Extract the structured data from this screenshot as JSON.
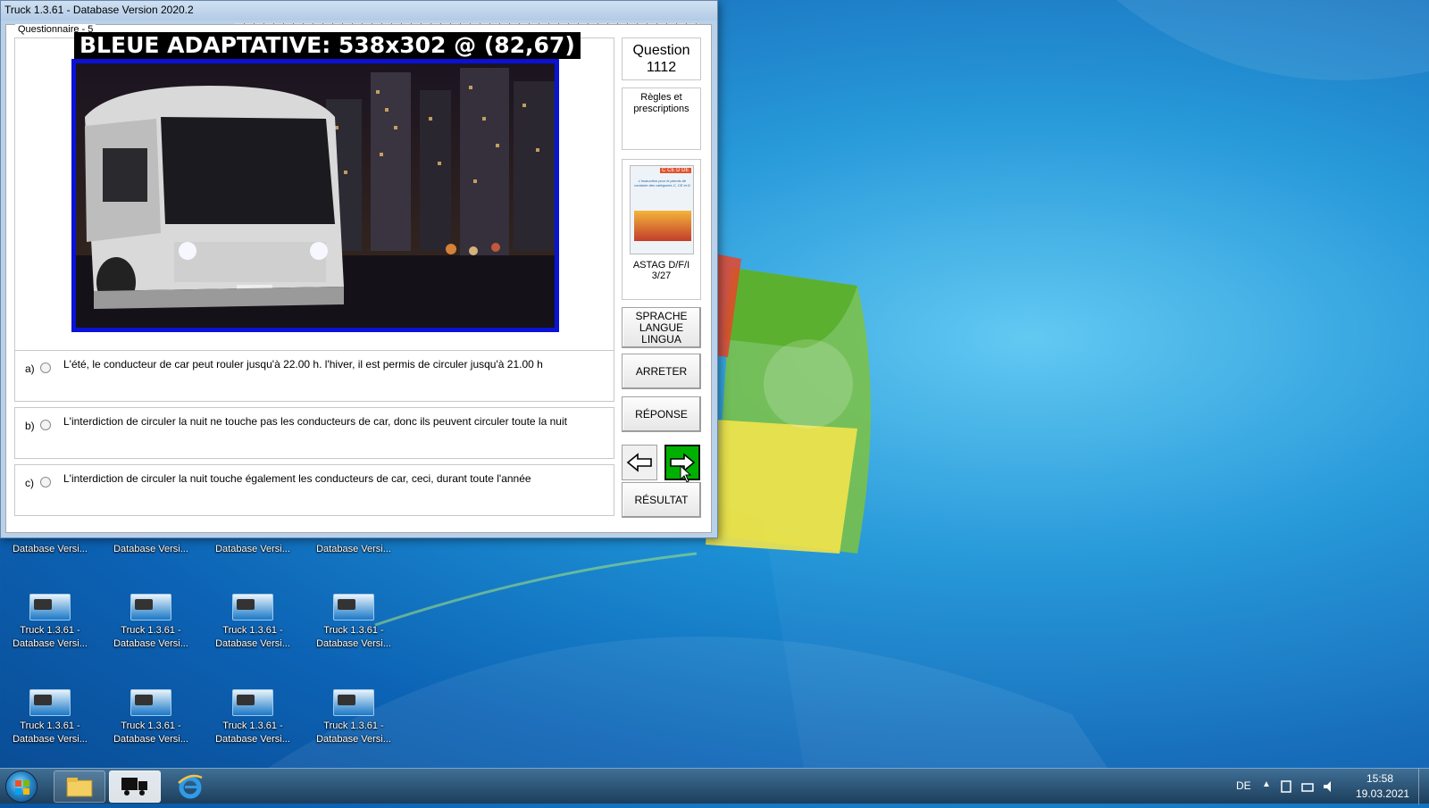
{
  "window": {
    "title": "Truck 1.3.61 - Database Version 2020.2",
    "group_label": "Questionnaire - 5",
    "overlay_label": "BLEUE ADAPTATIVE: 538x302 @ (82,67)"
  },
  "question": {
    "heading": "Question",
    "number": "1112",
    "category": "Règles et prescriptions",
    "book_source": "ASTAG D/F/I",
    "book_page": "3/27",
    "book_cover_text": "L'instruction pour le permis de conduire des catégories C, CE et D",
    "book_cover_tags": "C CE D DE"
  },
  "answers": [
    {
      "letter": "a)",
      "text": "L'été, le conducteur de car peut rouler jusqu'à 22.00 h. l'hiver, il est permis de circuler jusqu'à 21.00 h"
    },
    {
      "letter": "b)",
      "text": "L'interdiction de circuler la nuit ne touche pas les conducteurs de car, donc ils peuvent circuler toute la nuit"
    },
    {
      "letter": "c)",
      "text": "L'interdiction de circuler la nuit touche également les conducteurs de car, ceci, durant toute l'année"
    }
  ],
  "buttons": {
    "language": "SPRACHE LANGUE LINGUA",
    "stop": "ARRETER",
    "answer": "RÉPONSE",
    "result": "RÉSULTAT",
    "prev_icon": "arrow-left-icon",
    "next_icon": "arrow-right-icon"
  },
  "desktop_icons": [
    {
      "label": "Database Versi..."
    },
    {
      "label": "Database Versi..."
    },
    {
      "label": "Database Versi..."
    },
    {
      "label": "Database Versi..."
    },
    {
      "label": "Truck 1.3.61 - Database Versi..."
    },
    {
      "label": "Truck 1.3.61 - Database Versi..."
    },
    {
      "label": "Truck 1.3.61 - Database Versi..."
    },
    {
      "label": "Truck 1.3.61 - Database Versi..."
    },
    {
      "label": "Truck 1.3.61 - Database Versi..."
    },
    {
      "label": "Truck 1.3.61 - Database Versi..."
    },
    {
      "label": "Truck 1.3.61 - Database Versi..."
    },
    {
      "label": "Truck 1.3.61 - Database Versi..."
    }
  ],
  "taskbar": {
    "pinned": [
      "explorer-icon",
      "truck-app-icon",
      "internet-explorer-icon"
    ],
    "language": "DE",
    "time": "15:58",
    "date": "19.03.2021"
  },
  "colors": {
    "overlay_border": "#0a12d6",
    "next_button": "#00b000",
    "desktop_blue": "#1f95d8"
  }
}
